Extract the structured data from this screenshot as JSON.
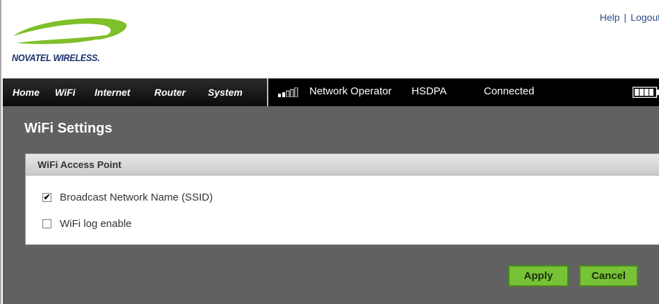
{
  "header": {
    "brand": "NOVATEL WIRELESS.",
    "links": {
      "help": "Help",
      "separator": "|",
      "logout": "Logout"
    }
  },
  "nav": {
    "items": [
      "Home",
      "WiFi",
      "Internet",
      "Router",
      "System"
    ]
  },
  "status": {
    "signal_bars_filled": 2,
    "signal_bars_total": 5,
    "operator": "Network Operator",
    "network_type": "HSDPA",
    "connection": "Connected",
    "battery_level": 1.0
  },
  "page": {
    "title": "WiFi Settings"
  },
  "panel": {
    "title": "WiFi Access Point",
    "options": [
      {
        "label": "Broadcast Network Name (SSID)",
        "checked": true
      },
      {
        "label": "WiFi log enable",
        "checked": false
      }
    ]
  },
  "buttons": {
    "apply": "Apply",
    "cancel": "Cancel"
  },
  "colors": {
    "button_green": "#77c236",
    "content_bg": "#616161",
    "nav_bg": "#000000",
    "brand_green": "#7fbf2a",
    "brand_blue": "#1b2f6e"
  }
}
